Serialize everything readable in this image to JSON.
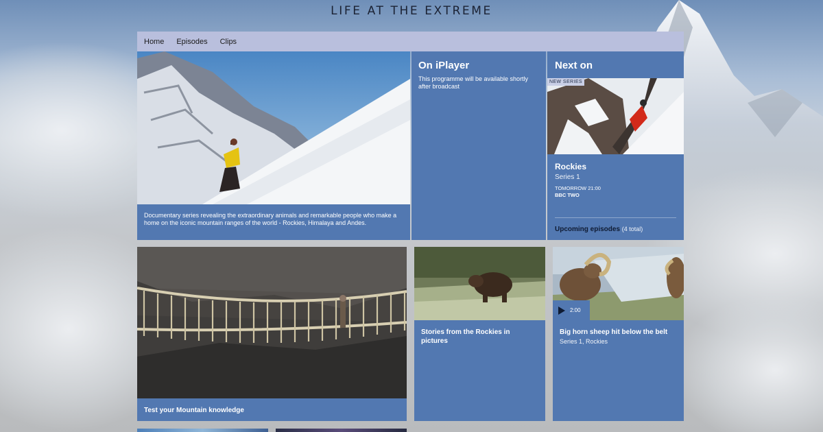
{
  "site": {
    "title": "LIFE AT THE EXTREME"
  },
  "nav": {
    "items": [
      "Home",
      "Episodes",
      "Clips"
    ]
  },
  "hero": {
    "description": "Documentary series revealing the extraordinary animals and remarkable people who make a home on the iconic mountain ranges of the world - Rockies, Himalaya and Andes."
  },
  "iplayer": {
    "heading": "On iPlayer",
    "message_line1": "This programme will be available shortly",
    "message_line2": "after broadcast"
  },
  "next_on": {
    "heading": "Next on",
    "badge": "NEW SERIES",
    "show_title": "Rockies",
    "series": "Series 1",
    "time": "TOMORROW 21:00",
    "channel": "BBC TWO",
    "upcoming_label": "Upcoming episodes",
    "upcoming_count": "(4 total)"
  },
  "tiles": [
    {
      "title": "Test your Mountain knowledge"
    },
    {
      "title_line1": "Stories from the Rockies in",
      "title_line2": "pictures"
    },
    {
      "title": "Big horn sheep hit below the belt",
      "subtitle": "Series 1, Rockies",
      "duration": "2:00"
    }
  ],
  "colors": {
    "panel": "#5278b1",
    "nav": "#b9bfdd",
    "badge": "#c9cfe6"
  },
  "icons": {
    "play": "play-icon"
  }
}
